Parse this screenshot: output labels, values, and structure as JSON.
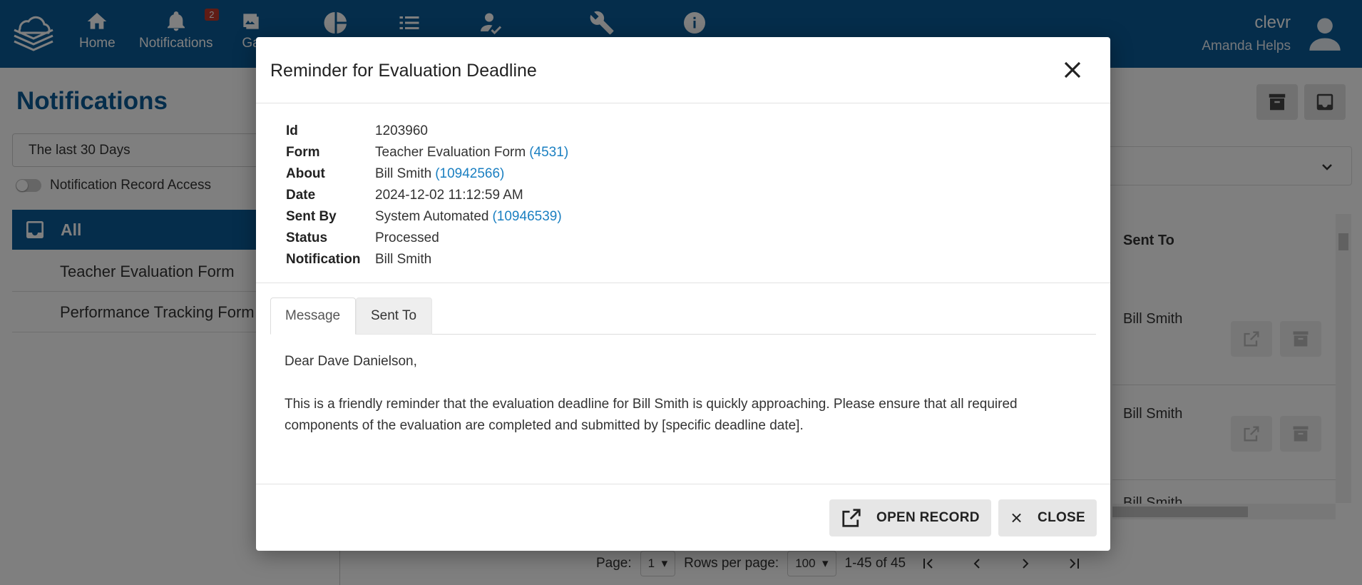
{
  "topbar": {
    "nav": [
      {
        "label": "Home",
        "icon": "home-icon"
      },
      {
        "label": "Notifications",
        "icon": "bell-icon",
        "badge": "2"
      },
      {
        "label": "Ga",
        "icon": "gallery-icon"
      }
    ],
    "icons_only": [
      "pie-chart-icon",
      "list-icon",
      "user-check-icon",
      "wrench-icon",
      "info-icon"
    ],
    "user": {
      "org": "clevr",
      "name": "Amanda Helps"
    }
  },
  "page": {
    "title": "Notifications",
    "date_filter": "The last 30 Days",
    "toggle_label": "Notification Record Access",
    "categories": {
      "all": "All",
      "items": [
        "Teacher Evaluation Form",
        "Performance Tracking Form"
      ]
    },
    "table": {
      "column_header": "Sent To",
      "rows": [
        "Bill Smith",
        "Bill Smith",
        "Bill Smith"
      ]
    },
    "pager": {
      "page_label": "Page:",
      "page_value": "1",
      "rows_label": "Rows per page:",
      "rows_value": "100",
      "range": "1-45 of 45"
    }
  },
  "modal": {
    "title": "Reminder for Evaluation Deadline",
    "details": {
      "id": {
        "label": "Id",
        "value": "1203960"
      },
      "form": {
        "label": "Form",
        "value": "Teacher Evaluation Form",
        "link": "(4531)"
      },
      "about": {
        "label": "About",
        "value": "Bill Smith",
        "link": "(10942566)"
      },
      "date": {
        "label": "Date",
        "value": "2024-12-02 11:12:59 AM"
      },
      "sent_by": {
        "label": "Sent By",
        "value": "System Automated",
        "link": "(10946539)"
      },
      "status": {
        "label": "Status",
        "value": "Processed"
      },
      "notification": {
        "label": "Notification",
        "value": "Bill Smith"
      }
    },
    "tabs": {
      "message": "Message",
      "sent_to": "Sent To"
    },
    "message": {
      "greeting": "Dear Dave Danielson,",
      "body": "This is a friendly reminder that the evaluation deadline for Bill Smith is quickly approaching. Please ensure that all required components of the evaluation are completed and submitted by [specific deadline date]."
    },
    "buttons": {
      "open_record": "OPEN RECORD",
      "close": "CLOSE"
    }
  }
}
